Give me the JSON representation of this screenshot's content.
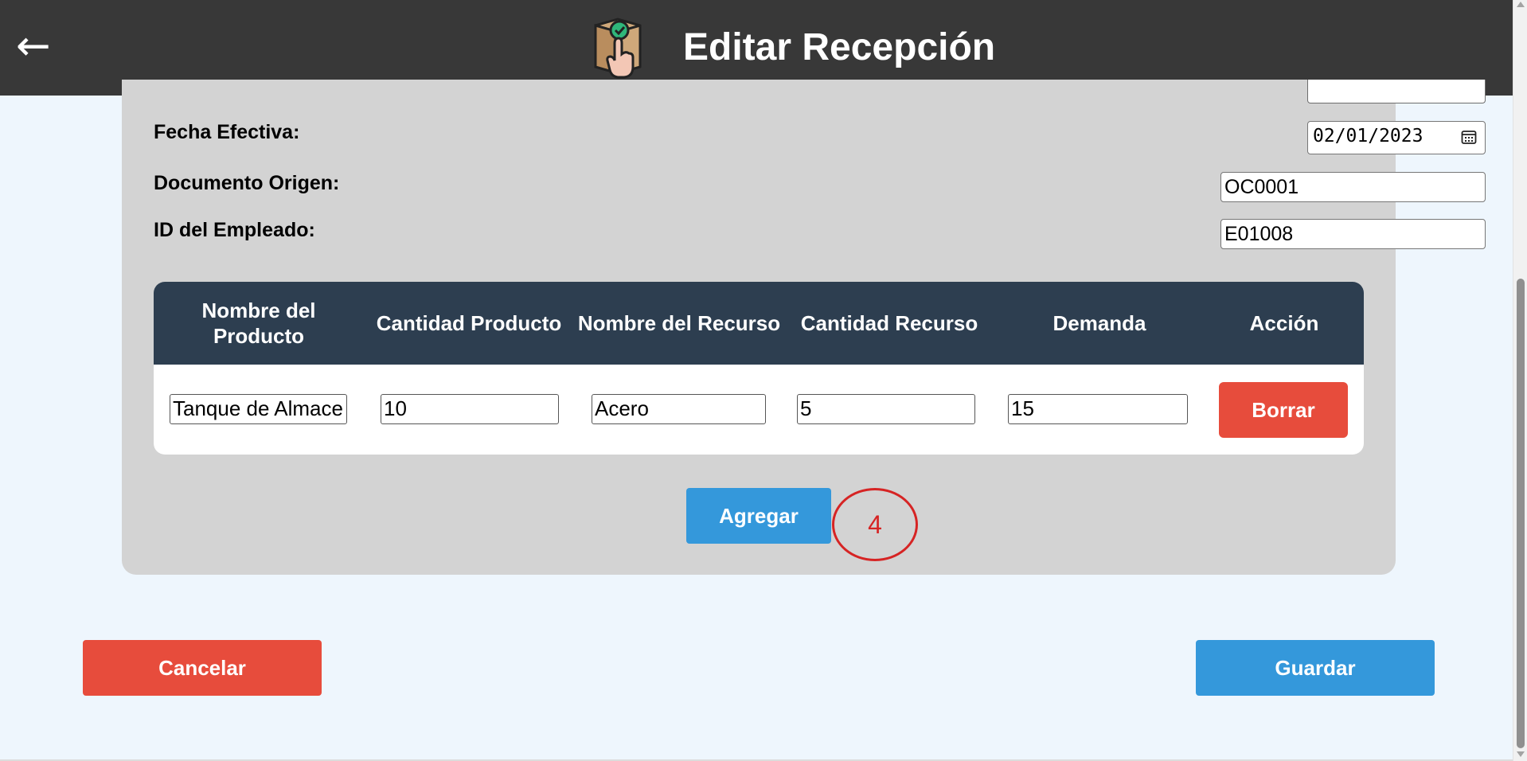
{
  "header": {
    "back_icon": "←",
    "title": "Editar Recepción",
    "logo_icon": "package-with-hand-icon"
  },
  "form": {
    "fecha_efectiva": {
      "label": "Fecha Efectiva:",
      "value": "02/01/2023"
    },
    "documento_origen": {
      "label": "Documento Origen:",
      "value": "OC0001"
    },
    "id_empleado": {
      "label": "ID del Empleado:",
      "value": "E01008"
    }
  },
  "table": {
    "headers": [
      "Nombre del Producto",
      "Cantidad Producto",
      "Nombre del Recurso",
      "Cantidad Recurso",
      "Demanda",
      "Acción"
    ],
    "rows": [
      {
        "nombre_producto": "Tanque de Almace",
        "cantidad_producto": "10",
        "nombre_recurso": "Acero",
        "cantidad_recurso": "5",
        "demanda": "15",
        "accion_label": "Borrar"
      }
    ]
  },
  "buttons": {
    "agregar": "Agregar",
    "cancelar": "Cancelar",
    "guardar": "Guardar"
  },
  "annotation": "4",
  "colors": {
    "header_bg": "#383838",
    "table_header_bg": "#2d3e50",
    "danger": "#e74c3c",
    "primary": "#3498db",
    "annotation": "#d62424"
  }
}
